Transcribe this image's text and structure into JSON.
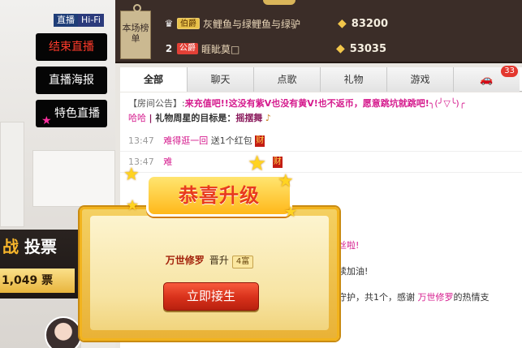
{
  "video": {
    "badge_live": "直播",
    "badge_hifi": "Hi-Fi",
    "buttons": {
      "end": "结束直播",
      "poster": "直播海报",
      "featured": "特色直播"
    },
    "vote": {
      "title_prefix": "战",
      "title": "投票",
      "count": "1,049",
      "unit": "票"
    }
  },
  "leaderboard": {
    "tab_label": "本场榜单",
    "rows": [
      {
        "rank_icon": "trophy-icon",
        "level": "伯爵",
        "name": "灰鲤鱼与绿鲤鱼与绿驴",
        "score": "83200"
      },
      {
        "rank": "2",
        "level": "公爵",
        "name": "睚眦莫□",
        "score": "53035"
      }
    ]
  },
  "tabs": [
    {
      "label": "全部",
      "active": true
    },
    {
      "label": "聊天"
    },
    {
      "label": "点歌"
    },
    {
      "label": "礼物"
    },
    {
      "label": "游戏"
    },
    {
      "label": "",
      "icon": "car-icon",
      "badge": "33"
    }
  ],
  "chat": {
    "announce_head": "【房间公告】:",
    "announce_text": "来充值吧!!这没有紫V也没有黄V!也不返币，愿意跳坑就跳吧!",
    "announce_deco": "╮(╯▽╰)╭",
    "announce_tail": "哈哈",
    "goal_label": "礼物周星的目标是：",
    "goal_value": "摇摆舞",
    "messages": [
      {
        "time": "13:47",
        "user": "难得逛一回",
        "text": "送1个红包",
        "tag": "财"
      },
      {
        "time": "13:47",
        "user": "难",
        "text": "",
        "tag": "财"
      }
    ],
    "frag1": "丝啦!",
    "frag2": "续加油!",
    "frag3_pre": "守护，共1个，感谢",
    "frag3_user": "万世修罗",
    "frag3_post": "的热情支"
  },
  "modal": {
    "title": "恭喜升级",
    "user": "万世修罗",
    "action": "晋升",
    "level": "4富",
    "button": "立即接生"
  }
}
